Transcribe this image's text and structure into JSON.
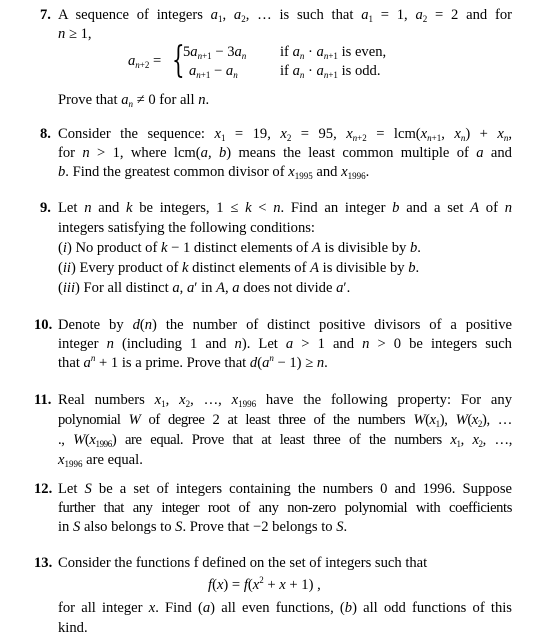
{
  "problems": [
    {
      "number": "7.",
      "lines": [
        "A sequence of integers a₁, a₂, … is such that a₁ = 1, a₂ = 2 and for",
        "n ≥ 1,"
      ],
      "equation": {
        "lhs": "a_{n+2} =",
        "cases": [
          {
            "expr": "5a_{n+1} − 3a_n",
            "condition": "if a_n · a_{n+1} is even,"
          },
          {
            "expr": "a_{n+1} − a_n",
            "condition": "if a_n · a_{n+1} is odd."
          }
        ]
      },
      "after": "Prove that a_n ≠ 0 for all n."
    },
    {
      "number": "8.",
      "lines": [
        "Consider the sequence: x₁ = 19, x₂ = 95, x_{n+2} = lcm(x_{n+1}, x_n) + x_n,",
        "for n > 1, where lcm(a, b) means the least common multiple of a and",
        "b. Find the greatest common divisor of x₁₉₉₅ and x₁₉₉₆."
      ]
    },
    {
      "number": "9.",
      "lines": [
        "Let n and k be integers, 1 ≤ k < n. Find an integer b and a set A of n",
        "integers satisfying the following conditions:",
        "(i) No product of k − 1 distinct elements of A is divisible by b.",
        "(ii) Every product of k distinct elements of A is divisible by b.",
        "(iii) For all distinct a, a′ in A, a does not divide a′."
      ]
    },
    {
      "number": "10.",
      "lines": [
        "Denote by d(n) the number of distinct positive divisors of a positive",
        "integer n (including 1 and n). Let a > 1 and n > 0 be integers such",
        "that aⁿ + 1 is a prime. Prove that d(aⁿ − 1) ≥ n."
      ]
    },
    {
      "number": "11.",
      "lines": [
        "Real numbers x₁, x₂, …, x₁₉₉₆ have the following property: For any",
        "polynomial W of degree 2 at least three of the numbers W(x₁), W(x₂), …",
        "., W(x₁₉₉₆) are equal. Prove that at least three of the numbers x₁, x₂, …,",
        "x₁₉₉₆ are equal."
      ]
    },
    {
      "number": "12.",
      "lines": [
        "Let S be a set of integers containing the numbers 0 and 1996. Suppose",
        "further that any integer root of any non-zero polynomial with coefficients",
        "in S also belongs to S. Prove that −2 belongs to S."
      ]
    },
    {
      "number": "13.",
      "lines": [
        "Consider the functions f defined on the set of integers such that"
      ],
      "equation": "f(x) = f(x² + x + 1) ,",
      "after_lines": [
        "for all integer x. Find (a) all even functions, (b) all odd functions of this",
        "kind."
      ]
    }
  ]
}
